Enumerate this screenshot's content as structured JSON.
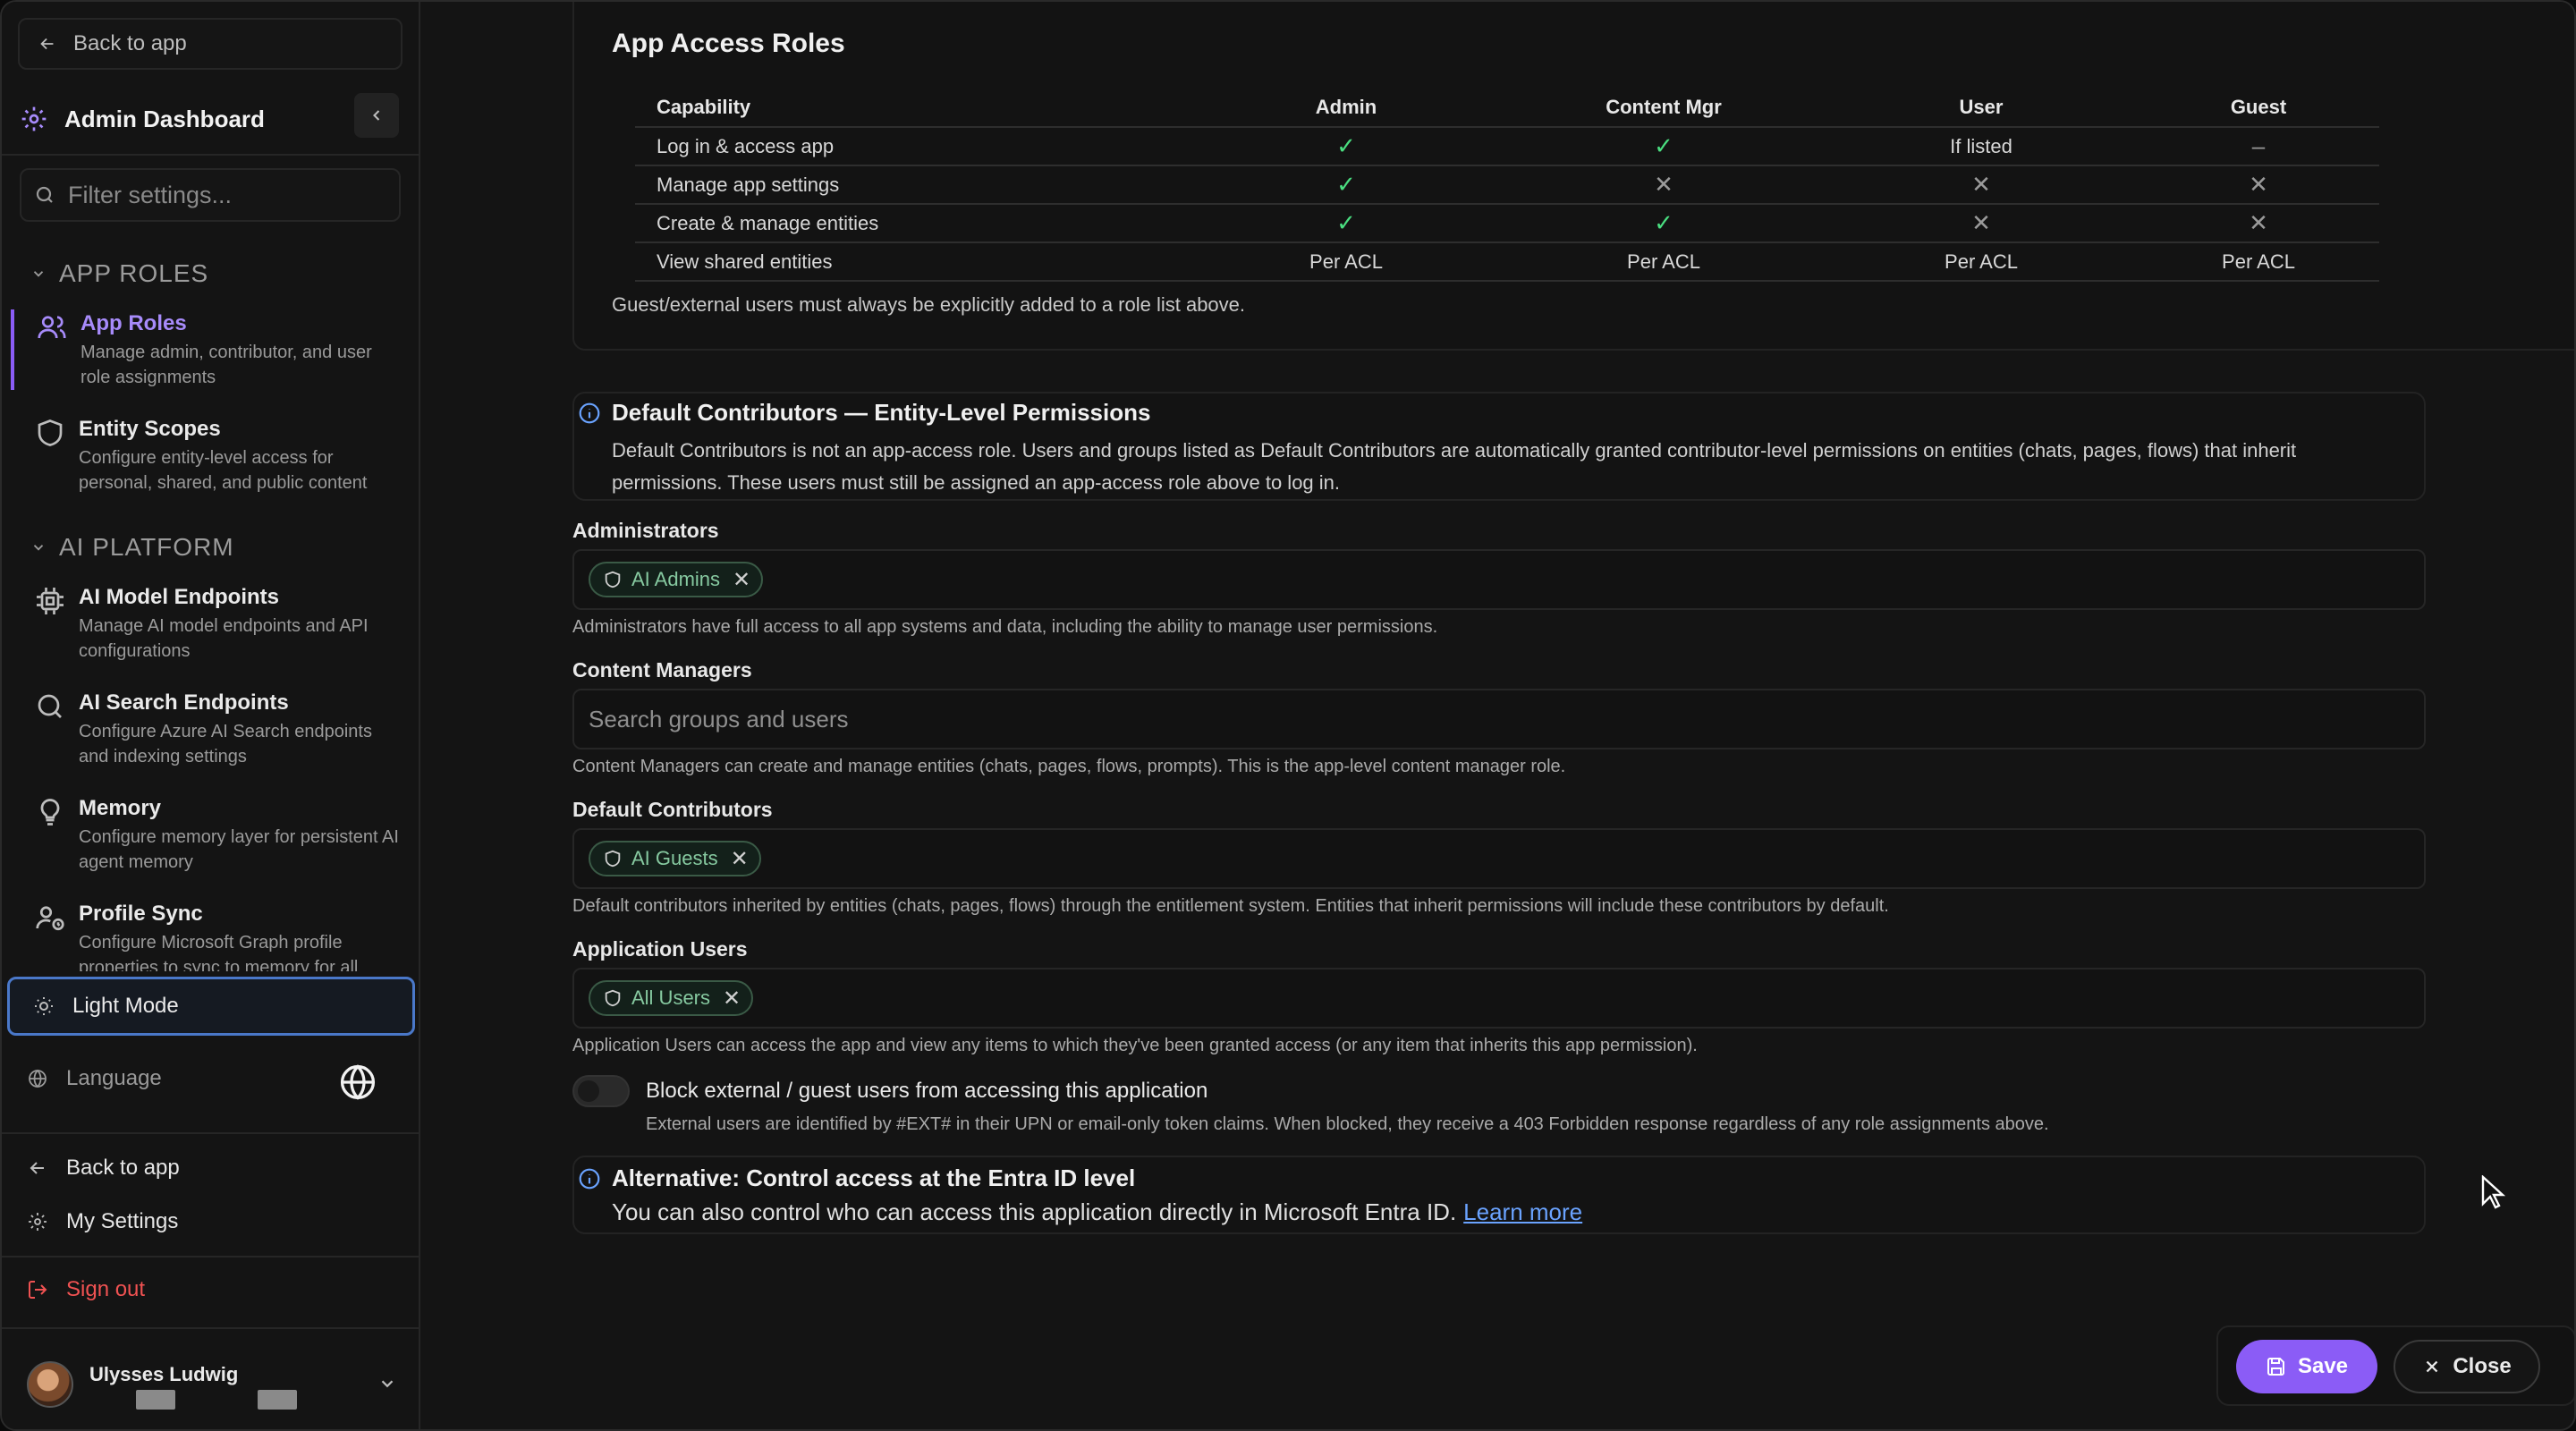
{
  "sidebar": {
    "back_top": "Back to app",
    "header_title": "Admin Dashboard",
    "filter_placeholder": "Filter settings...",
    "sections": [
      {
        "title": "APP ROLES",
        "items": [
          {
            "label": "App Roles",
            "desc": "Manage admin, contributor, and user role assignments",
            "icon": "users-icon",
            "active": true
          },
          {
            "label": "Entity Scopes",
            "desc": "Configure entity-level access for personal, shared, and public content",
            "icon": "shield-icon"
          }
        ]
      },
      {
        "title": "AI PLATFORM",
        "items": [
          {
            "label": "AI Model Endpoints",
            "desc": "Manage AI model endpoints and API configurations",
            "icon": "cpu-icon"
          },
          {
            "label": "AI Search Endpoints",
            "desc": "Configure Azure AI Search endpoints and indexing settings",
            "icon": "search-icon"
          },
          {
            "label": "Memory",
            "desc": "Configure memory layer for persistent AI agent memory",
            "icon": "lightbulb-icon"
          },
          {
            "label": "Profile Sync",
            "desc": "Configure Microsoft Graph profile properties to sync to memory for all",
            "icon": "user-sync-icon"
          }
        ]
      }
    ],
    "light_mode": "Light Mode",
    "language": "Language",
    "back_bottom": "Back to app",
    "my_settings": "My Settings",
    "sign_out": "Sign out",
    "user_name": "Ulysses Ludwig"
  },
  "roles": {
    "title": "App Access Roles",
    "columns": [
      "Capability",
      "Admin",
      "Content Mgr",
      "User",
      "Guest"
    ],
    "rows": [
      [
        "Log in & access app",
        "check",
        "check",
        "If listed",
        "dash"
      ],
      [
        "Manage app settings",
        "check",
        "x",
        "x",
        "x"
      ],
      [
        "Create & manage entities",
        "check",
        "check",
        "x",
        "x"
      ],
      [
        "View shared entities",
        "Per ACL",
        "Per ACL",
        "Per ACL",
        "Per ACL"
      ]
    ],
    "note": "Guest/external users must always be explicitly added to a role list above."
  },
  "default_info": {
    "title": "Default Contributors — Entity-Level Permissions",
    "body": "Default Contributors is not an app-access role. Users and groups listed as Default Contributors are automatically granted contributor-level permissions on entities (chats, pages, flows) that inherit permissions. These users must still be assigned an app-access role above to log in."
  },
  "fields": {
    "administrators": {
      "label": "Administrators",
      "chip": "AI Admins",
      "help": "Administrators have full access to all app systems and data, including the ability to manage user permissions."
    },
    "content_managers": {
      "label": "Content Managers",
      "placeholder": "Search groups and users",
      "help": "Content Managers can create and manage entities (chats, pages, flows, prompts). This is the app-level content manager role."
    },
    "default_contributors": {
      "label": "Default Contributors",
      "chip": "AI Guests",
      "help": "Default contributors inherited by entities (chats, pages, flows) through the entitlement system. Entities that inherit permissions will include these contributors by default."
    },
    "application_users": {
      "label": "Application Users",
      "chip": "All Users",
      "help": "Application Users can access the app and view any items to which they've been granted access (or any item that inherits this app permission)."
    }
  },
  "block_toggle": {
    "title": "Block external / guest users from accessing this application",
    "desc": "External users are identified by #EXT# in their UPN or email-only token claims. When blocked, they receive a 403 Forbidden response regardless of any role assignments above.",
    "enabled": false
  },
  "alt_info": {
    "title": "Alternative: Control access at the Entra ID level",
    "body": "You can also control who can access this application directly in Microsoft Entra ID.",
    "link": "Learn more"
  },
  "footer": {
    "save": "Save",
    "close": "Close"
  },
  "colors": {
    "accent": "#8b5cf6",
    "check": "#4ade80",
    "link": "#6aa3ff",
    "danger": "#f05252"
  }
}
